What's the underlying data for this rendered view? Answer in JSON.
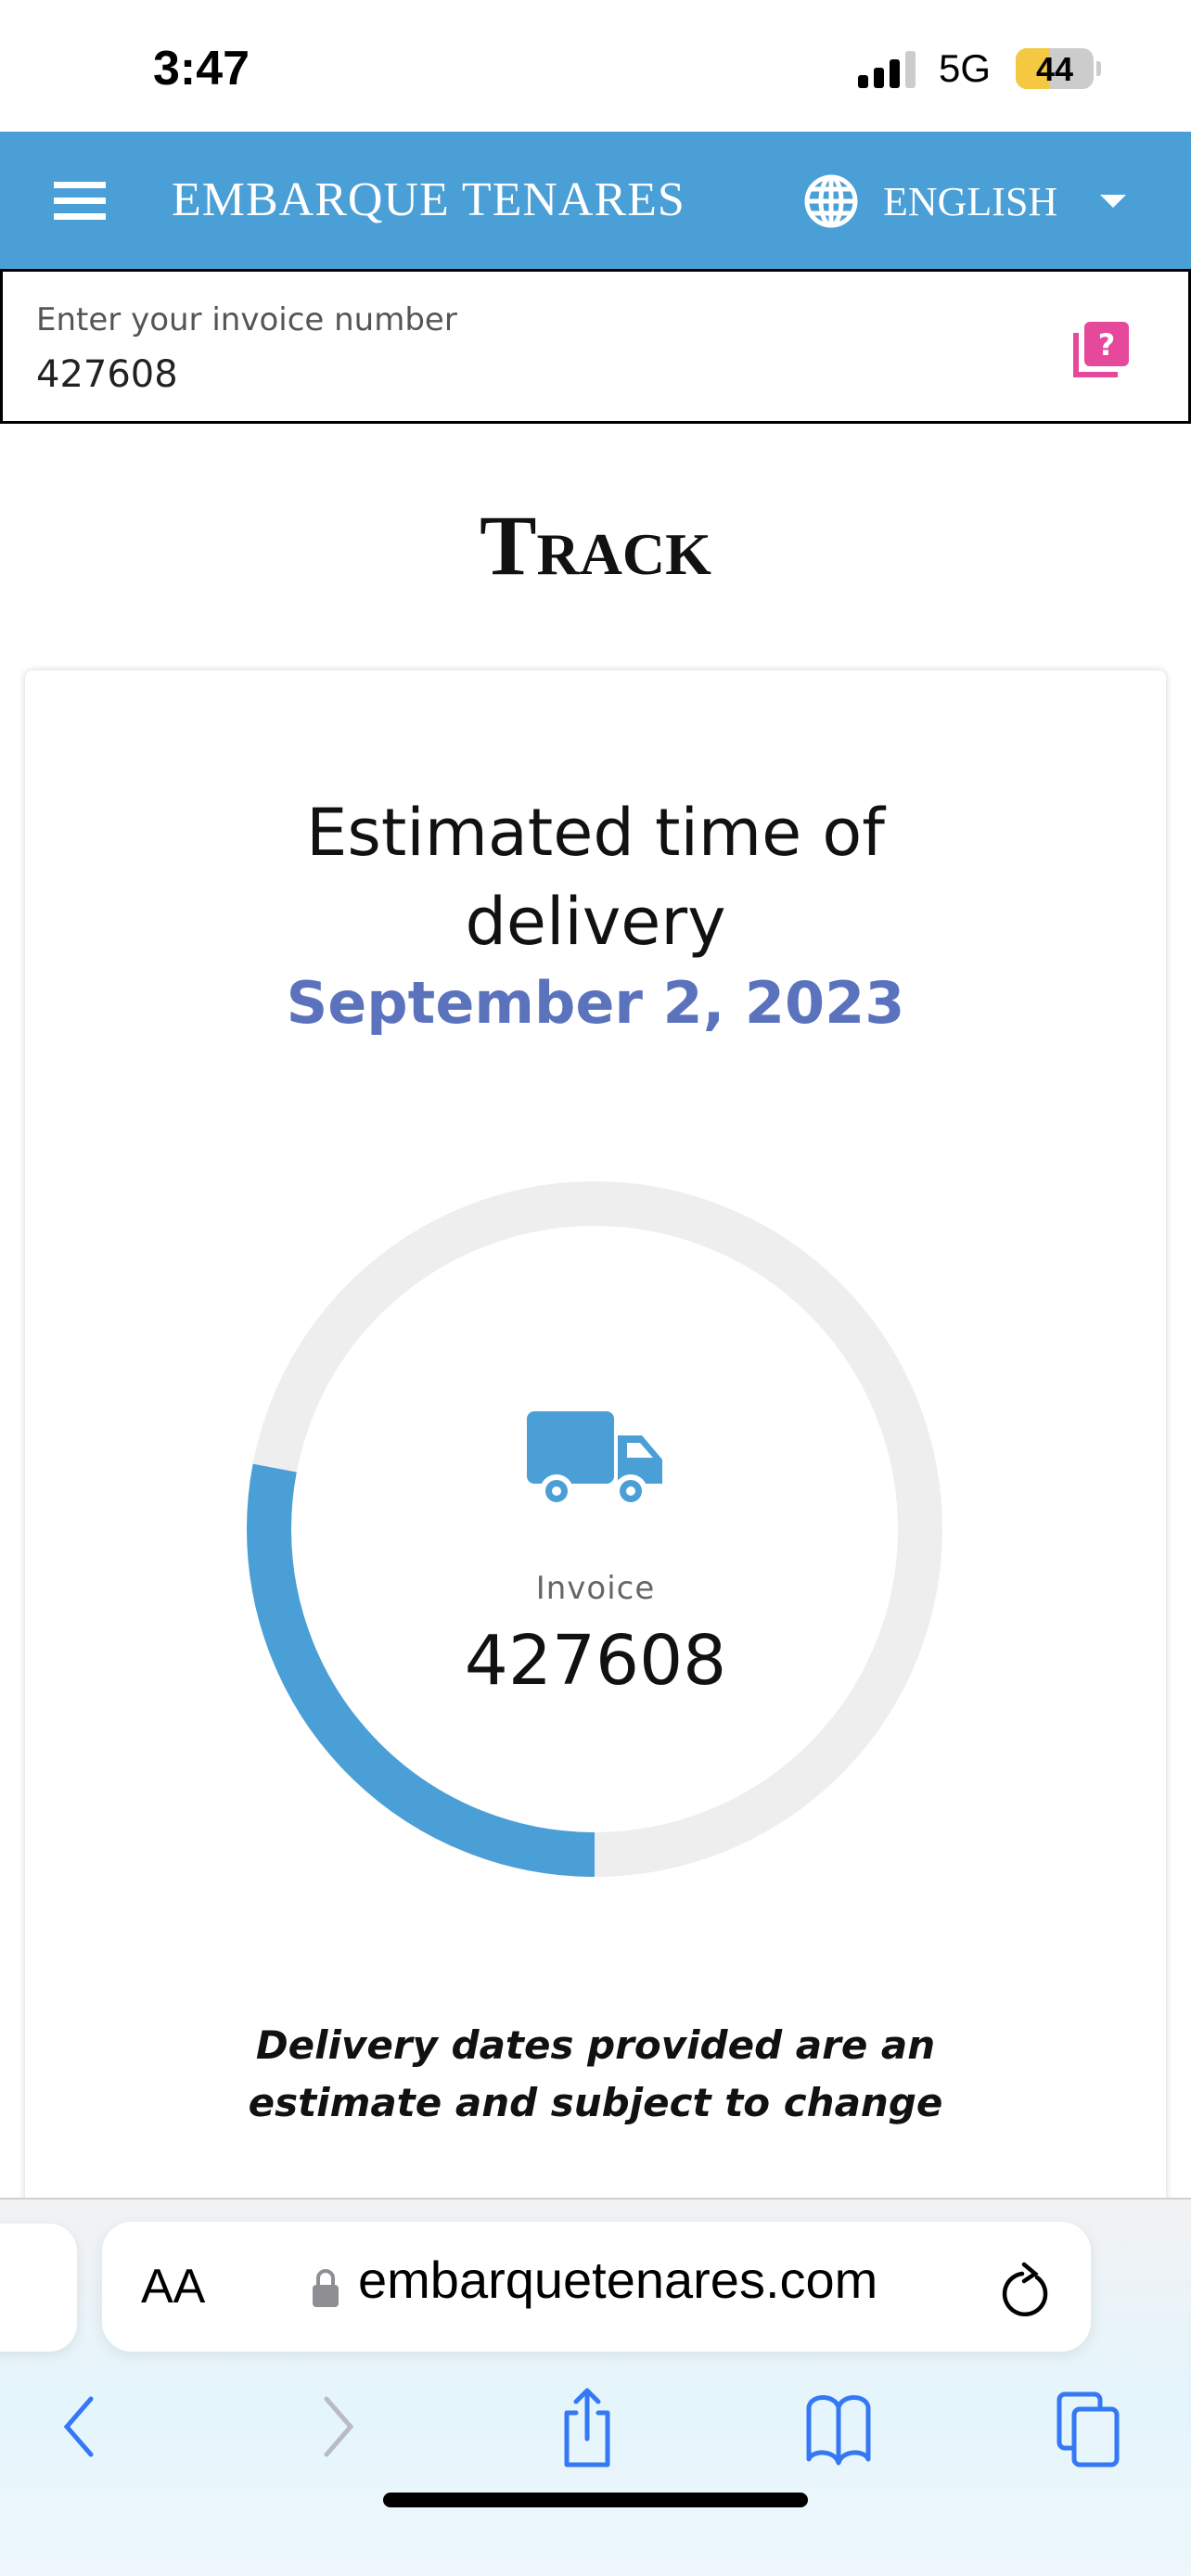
{
  "status_bar": {
    "time": "3:47",
    "network": "5G",
    "battery": "44",
    "battery_level_percent": 44
  },
  "header": {
    "brand": "EMBARQUE TENARES",
    "language": "ENGLISH",
    "menu_icon": "hamburger-icon",
    "language_icon": "globe-icon",
    "color": "#4a9fd6"
  },
  "search": {
    "label": "Enter your invoice number",
    "value": "427608",
    "help_icon": "help-question-icon",
    "help_color": "#e6499c"
  },
  "page": {
    "title": "Track"
  },
  "tracking": {
    "eta_label": "Estimated time of delivery",
    "eta_date": "September 2, 2023",
    "eta_color": "#5b73bd",
    "progress_fraction": 0.28,
    "progress_color": "#4a9fd6",
    "icon": "truck-icon",
    "invoice_label": "Invoice",
    "invoice_number": "427608",
    "disclaimer": "Delivery dates provided are an estimate and subject to change"
  },
  "browser": {
    "text_size_label": "AA",
    "url": "embarquetenares.com",
    "toolbar": [
      "back-icon",
      "forward-icon",
      "share-icon",
      "bookmarks-icon",
      "tabs-icon"
    ]
  }
}
